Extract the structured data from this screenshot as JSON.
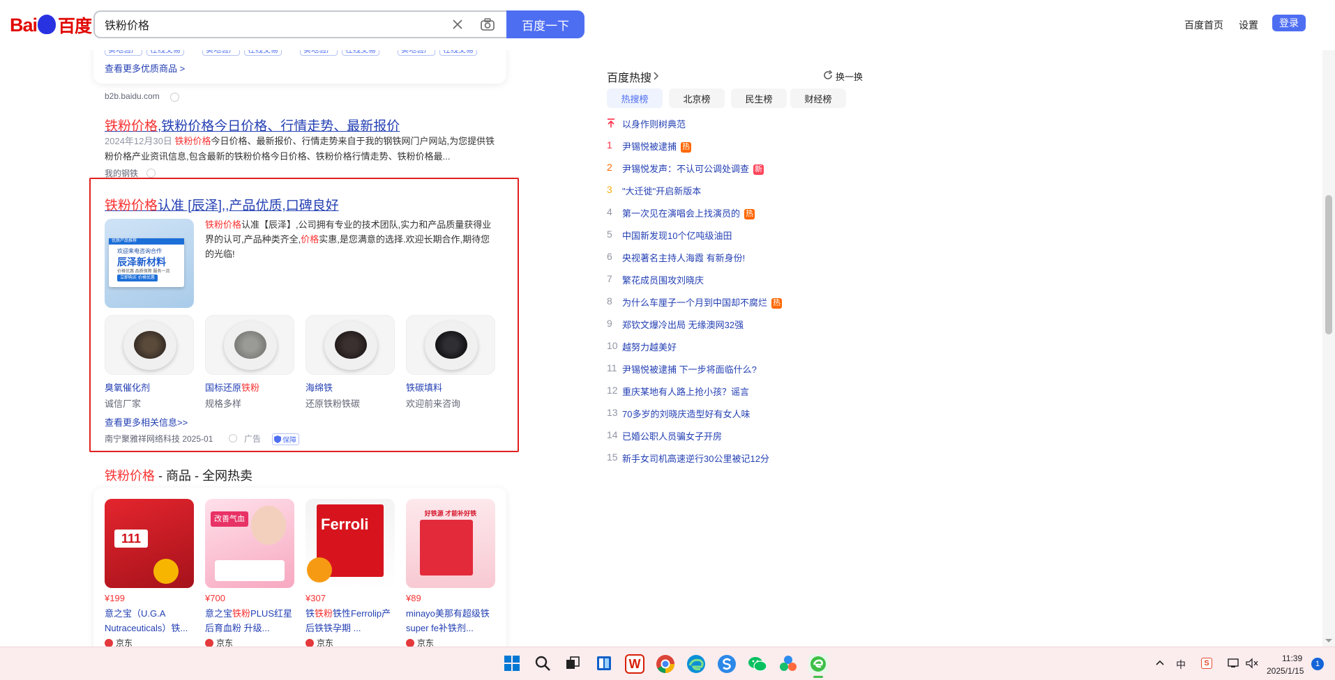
{
  "header": {
    "logo_left": "Bai",
    "logo_right": "百度",
    "search_value": "铁粉价格",
    "search_button": "百度一下",
    "links": [
      "百度首页",
      "设置"
    ],
    "login": "登录"
  },
  "top_card": {
    "tags": [
      "实地验厂",
      "在线交易",
      "实地验厂",
      "在线交易",
      "实地验厂",
      "在线交易",
      "实地验厂",
      "在线交易"
    ],
    "more_link": "查看更多优质商品 >",
    "source": "b2b.baidu.com"
  },
  "result1": {
    "title_red": "铁粉价格",
    "title_rest": ",铁粉价格今日价格、行情走势、最新报价",
    "date": "2024年12月30日",
    "abstract_red": "铁粉价格",
    "abstract_rest": "今日价格、最新报价、行情走势来自于我的钢铁网门户网站,为您提供铁粉价格产业资讯信息,包含最新的铁粉价格今日价格、铁粉价格行情走势、铁粉价格最...",
    "source": "我的钢铁"
  },
  "ad": {
    "title_red": "铁粉价格",
    "title_rest": "认准 [辰泽],,产品优质,口碑良好",
    "thumb_top": "优质产品推荐",
    "thumb_line1": "欢迎来电咨询合作",
    "thumb_brand": "辰泽新材料",
    "thumb_sub": "价格优惠 品质保障 服务一流",
    "thumb_btn": "立即购买 价格优惠",
    "abstract_red1": "铁粉价格",
    "abstract_mid": "认准【辰泽】,公司拥有专业的技术团队,实力和产品质量获得业界的认可,产品种类齐全,",
    "abstract_red2": "价格",
    "abstract_end": "实惠,是您满意的选择.欢迎长期合作,期待您的光临!",
    "products": [
      {
        "name": "臭氧催化剂",
        "name_red": "",
        "sub": "诚信厂家"
      },
      {
        "name": "国标还原",
        "name_red": "铁粉",
        "sub": "规格多样"
      },
      {
        "name": "海绵铁",
        "name_red": "",
        "sub": "还原铁粉铁碳"
      },
      {
        "name": "铁碳填料",
        "name_red": "",
        "sub": "欢迎前来咨询"
      }
    ],
    "more_link": "查看更多相关信息>>",
    "company": "南宁聚雅祥网络科技 2025-01",
    "ad_label": "广告",
    "guarantee": "保障"
  },
  "shop": {
    "title_red": "铁粉价格",
    "title_rest": " - 商品 - 全网热卖",
    "items": [
      {
        "price": "¥199",
        "name": "意之宝（U.G.A Nutraceuticals）铁...",
        "source": "京东",
        "img_text": "111"
      },
      {
        "price": "¥700",
        "name_a": "意之宝",
        "name_red": "铁粉",
        "name_b": "PLUS红星后育血粉 升级...",
        "source": "京东",
        "img_text": "改善气血"
      },
      {
        "price": "¥307",
        "name_a": "铁",
        "name_red": "铁粉",
        "name_b": "铁性Ferrolip产后铁铁孕期 ...",
        "source": "京东",
        "img_text": "Ferroli"
      },
      {
        "price": "¥89",
        "name": "minayo美那有超级铁super fe补铁剂...",
        "source": "京东",
        "img_text": "好铁源 才能补好铁"
      }
    ]
  },
  "hot": {
    "title": "百度热搜",
    "refresh": "换一换",
    "tabs": [
      "热搜榜",
      "北京榜",
      "民生榜",
      "财经榜"
    ],
    "items": [
      {
        "num": "",
        "text": "以身作则树典范",
        "badge": ""
      },
      {
        "num": "1",
        "text": "尹锡悦被逮捕",
        "badge": "热"
      },
      {
        "num": "2",
        "text": "尹锡悦发声：不认可公调处调查",
        "badge": "新"
      },
      {
        "num": "3",
        "text": "\"大迁徙\"开启新版本",
        "badge": ""
      },
      {
        "num": "4",
        "text": "第一次见在演唱会上找演员的",
        "badge": "热"
      },
      {
        "num": "5",
        "text": "中国新发现10个亿吨级油田",
        "badge": ""
      },
      {
        "num": "6",
        "text": "央视著名主持人海霞 有新身份!",
        "badge": ""
      },
      {
        "num": "7",
        "text": "繁花成员围攻刘晓庆",
        "badge": ""
      },
      {
        "num": "8",
        "text": "为什么车厘子一个月到中国却不腐烂",
        "badge": "热"
      },
      {
        "num": "9",
        "text": "郑钦文爆冷出局 无缘澳网32强",
        "badge": ""
      },
      {
        "num": "10",
        "text": "越努力越美好",
        "badge": ""
      },
      {
        "num": "11",
        "text": "尹锡悦被逮捕 下一步将面临什么?",
        "badge": ""
      },
      {
        "num": "12",
        "text": "重庆某地有人路上抢小孩？谣言",
        "badge": ""
      },
      {
        "num": "13",
        "text": "70多岁的刘晓庆造型好有女人味",
        "badge": ""
      },
      {
        "num": "14",
        "text": "已婚公职人员骗女子开房",
        "badge": ""
      },
      {
        "num": "15",
        "text": "新手女司机高速逆行30公里被记12分",
        "badge": ""
      }
    ]
  },
  "taskbar": {
    "time": "11:39",
    "date": "2025/1/15",
    "ime": "中",
    "notif_count": "1"
  },
  "colors": {
    "brand_blue": "#4e6ef2",
    "link_blue": "#2440b3",
    "highlight_red": "#f73131",
    "ad_border": "#e02020",
    "taskbar_bg": "#fbecee"
  }
}
